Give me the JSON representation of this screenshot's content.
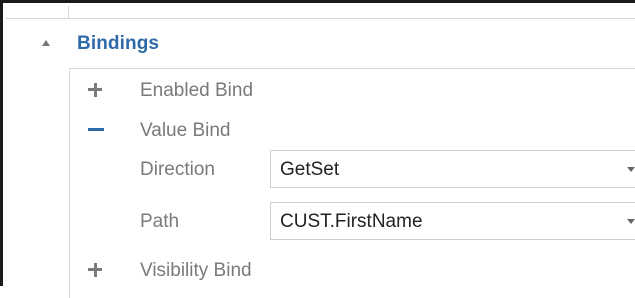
{
  "section": {
    "title": "Bindings",
    "expanded": true,
    "collapse_icon": "triangle-up-icon"
  },
  "binds": [
    {
      "label": "Enabled Bind",
      "state": "collapsed",
      "icon": "plus-icon"
    },
    {
      "label": "Value Bind",
      "state": "expanded",
      "icon": "minus-icon"
    },
    {
      "label": "Visibility Bind",
      "state": "collapsed",
      "icon": "plus-icon"
    }
  ],
  "value_bind": {
    "direction": {
      "label": "Direction",
      "value": "GetSet",
      "icon": "dropdown-caret-icon"
    },
    "path": {
      "label": "Path",
      "value": "CUST.FirstName",
      "icon": "dropdown-caret-icon"
    }
  },
  "colors": {
    "accent": "#2f6aa8",
    "label_gray": "#7a7a7a",
    "value_text": "#222222",
    "border": "#cfcfcf"
  }
}
